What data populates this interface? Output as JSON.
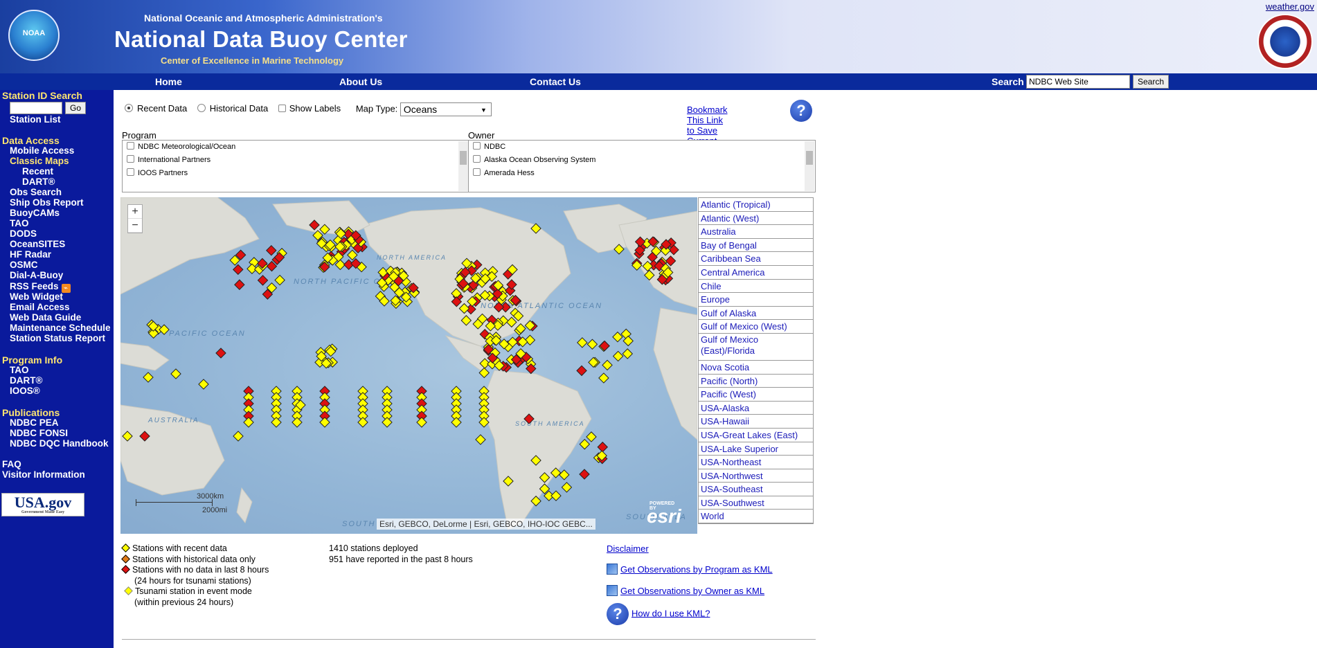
{
  "header": {
    "agency": "National Oceanic and Atmospheric Administration's",
    "title": "National Data Buoy Center",
    "subtitle": "Center of Excellence in Marine Technology",
    "weather_link": "weather.gov",
    "noaa_logo_text": "NOAA"
  },
  "nav": {
    "home": "Home",
    "about": "About Us",
    "contact": "Contact Us",
    "search_label": "Search",
    "search_value": "NDBC Web Site",
    "search_button": "Search"
  },
  "sidebar": {
    "station_id_search": "Station ID Search",
    "go": "Go",
    "station_list": "Station List",
    "data_access": "Data Access",
    "mobile_access": "Mobile Access",
    "classic_maps": "Classic Maps",
    "recent": "Recent",
    "dart": "DART®",
    "obs_search": "Obs Search",
    "ship_obs_report": "Ship Obs Report",
    "buoycams": "BuoyCAMs",
    "tao": "TAO",
    "dods": "DODS",
    "oceansites": "OceanSITES",
    "hf_radar": "HF Radar",
    "osmc": "OSMC",
    "dial_a_buoy": "Dial-A-Buoy",
    "rss_feeds": "RSS Feeds",
    "web_widget": "Web Widget",
    "email_access": "Email Access",
    "web_data_guide": "Web Data Guide",
    "maintenance_schedule": "Maintenance Schedule",
    "station_status_report": "Station Status Report",
    "program_info": "Program Info",
    "pi_tao": "TAO",
    "pi_dart": "DART®",
    "pi_ioos": "IOOS®",
    "publications": "Publications",
    "ndbc_pea": "NDBC PEA",
    "ndbc_fonsi": "NDBC FONSI",
    "ndbc_dqc": "NDBC DQC Handbook",
    "faq": "FAQ",
    "visitor_information": "Visitor Information",
    "usagov": "USA.gov",
    "usagov_tagline": "Government Made Easy"
  },
  "controls": {
    "recent_data": "Recent Data",
    "historical_data": "Historical Data",
    "show_labels": "Show Labels",
    "map_type_label": "Map Type:",
    "map_type_value": "Oceans",
    "bookmark": "Bookmark This Link to Save Current Map View!",
    "help": "?"
  },
  "program_filter": {
    "label": "Program Filter:",
    "items": [
      "NDBC Meteorological/Ocean",
      "International Partners",
      "IOOS Partners"
    ]
  },
  "owner_filter": {
    "label": "Owner Filter:",
    "items": [
      "NDBC",
      "Alaska Ocean Observing System",
      "Amerada Hess"
    ]
  },
  "map": {
    "zoom_in": "+",
    "zoom_out": "−",
    "scale_km": "3000km",
    "scale_mi": "2000mi",
    "attribution": "Esri, GEBCO, DeLorme | Esri, GEBCO, IHO-IOC GEBC...",
    "esri": "esri",
    "esri_powered": "POWERED BY",
    "labels": {
      "north_pacific": "NORTH PACIFIC OCEAN",
      "north_atlantic": "NORTH ATLANTIC OCEAN",
      "pacific_ocean": "PACIFIC OCEAN",
      "south_atlantic": "SOUTH ATLA",
      "north_america": "NORTH AMERICA",
      "south_america": "SOUTH AMERICA",
      "australia": "AUSTRALIA",
      "south": "SOUTH"
    },
    "colors": {
      "recent": "#ffff00",
      "historical": "#e07a18",
      "no_data": "#dd1111",
      "tsunami": "#ffff00"
    }
  },
  "regions": [
    "Atlantic (Tropical)",
    "Atlantic (West)",
    "Australia",
    "Bay of Bengal",
    "Caribbean Sea",
    "Central America",
    "Chile",
    "Europe",
    "Gulf of Alaska",
    "Gulf of Mexico (West)",
    "Gulf of Mexico (East)/Florida",
    "Nova Scotia",
    "Pacific (North)",
    "Pacific (West)",
    "USA-Alaska",
    "USA-Hawaii",
    "USA-Great Lakes (East)",
    "USA-Lake Superior",
    "USA-Northeast",
    "USA-Northwest",
    "USA-Southeast",
    "USA-Southwest",
    "World"
  ],
  "legend": {
    "recent": "Stations with recent data",
    "historical": "Stations with historical data only",
    "no_data": "Stations with no data in last 8 hours",
    "no_data_note": "(24 hours for tsunami stations)",
    "tsunami": "Tsunami station in event mode",
    "tsunami_note": "(within previous 24 hours)"
  },
  "stats": {
    "deployed": "1410 stations deployed",
    "reported": "951 have reported in the past 8 hours"
  },
  "links": {
    "disclaimer": "Disclaimer",
    "kml_program": "Get Observations by Program as KML",
    "kml_owner": "Get Observations by Owner as KML",
    "kml_help": "How do I use KML?"
  }
}
